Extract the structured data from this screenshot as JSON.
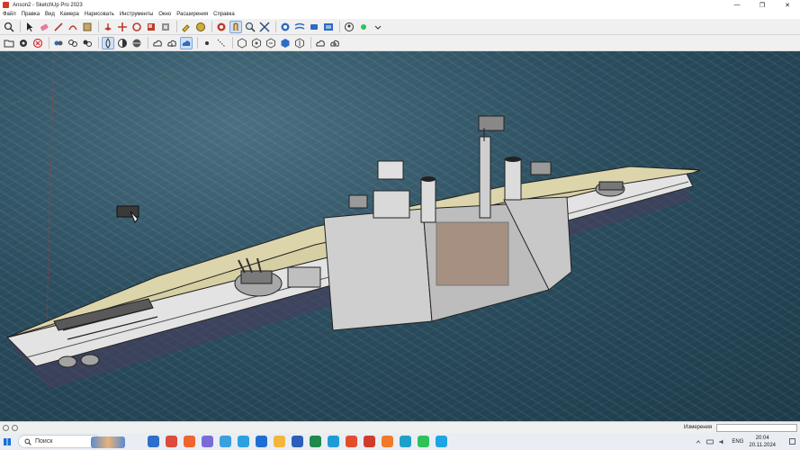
{
  "window": {
    "title": "Anson2 - SketchUp Pro 2023",
    "minimize": "—",
    "maximize": "❐",
    "close": "✕"
  },
  "menu": [
    "Файл",
    "Правка",
    "Вид",
    "Камера",
    "Нарисовать",
    "Инструменты",
    "Окно",
    "Расширения",
    "Справка"
  ],
  "toolbar1": [
    "select-icon",
    "eraser-icon",
    "line-icon",
    "arc-icon",
    "shape-icon",
    "pushpull-icon",
    "move-icon",
    "rotate-icon",
    "scale-icon",
    "offset-icon",
    "paint-icon",
    "tape-icon",
    "text-icon",
    "orbit-icon",
    "pan-icon",
    "zoom-icon",
    "zoom-extents-icon",
    "warehouse-icon",
    "extension-icon",
    "sandbox-icon",
    "layout-icon",
    "account-icon"
  ],
  "toolbar2": [
    "open-icon",
    "settings-icon",
    "cancel-icon",
    "cloud-icon",
    "component-icon",
    "group-icon",
    "water-icon",
    "shadow-icon",
    "style-icon",
    "cloud-upload-icon",
    "cloud-download-icon",
    "model-info-icon",
    "point-icon",
    "guide-icon",
    "hex1-icon",
    "hex2-icon",
    "hex3-icon",
    "hex4-icon",
    "hex5-icon",
    "cloud2-icon",
    "cloud3-icon"
  ],
  "status": {
    "measure_label": "Измерения",
    "measure_value": ""
  },
  "taskbar": {
    "search_label": "Поиск",
    "apps": [
      {
        "name": "app-taskview",
        "color": "#2f6ec9"
      },
      {
        "name": "app-chrome",
        "color": "#de4a3b"
      },
      {
        "name": "app-brave",
        "color": "#f0642e"
      },
      {
        "name": "app-teams",
        "color": "#7b6bd6"
      },
      {
        "name": "app-copilot",
        "color": "#3aa0e0"
      },
      {
        "name": "app-paperplane",
        "color": "#2aa2e0"
      },
      {
        "name": "app-outlook",
        "color": "#1f6fd0"
      },
      {
        "name": "app-files",
        "color": "#f2b73a"
      },
      {
        "name": "app-word",
        "color": "#2b5fb8"
      },
      {
        "name": "app-excel",
        "color": "#1f8a4c"
      },
      {
        "name": "app-photos",
        "color": "#1f9bd8"
      },
      {
        "name": "app-store",
        "color": "#e34d2e"
      },
      {
        "name": "app-sketchup",
        "color": "#d23b2a"
      },
      {
        "name": "app-firefox",
        "color": "#f07a2a"
      },
      {
        "name": "app-edge",
        "color": "#1fa0c8"
      },
      {
        "name": "app-whatsapp",
        "color": "#2ec35a"
      },
      {
        "name": "app-skype",
        "color": "#1ea5e2"
      }
    ],
    "lang": "ENG",
    "time": "20:04",
    "date": "20.11.2024"
  }
}
